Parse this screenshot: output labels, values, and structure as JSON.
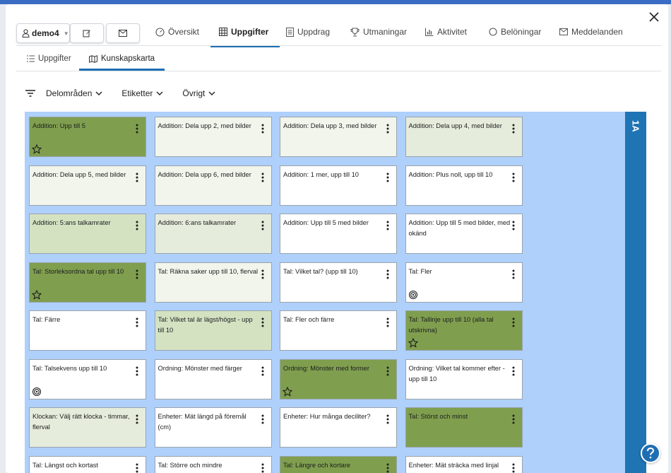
{
  "header": {
    "user_name": "demo4",
    "tabs": [
      {
        "label": "Översikt",
        "icon": "dashboard-icon"
      },
      {
        "label": "Uppgifter",
        "icon": "table-icon",
        "active": true
      },
      {
        "label": "Uppdrag",
        "icon": "document-icon"
      },
      {
        "label": "Utmaningar",
        "icon": "trophy-icon"
      },
      {
        "label": "Aktivitet",
        "icon": "bar-chart-icon"
      },
      {
        "label": "Belöningar",
        "icon": "circle-icon"
      },
      {
        "label": "Meddelanden",
        "icon": "envelope-icon"
      }
    ]
  },
  "subtabs": [
    {
      "label": "Uppgifter",
      "icon": "list-icon"
    },
    {
      "label": "Kunskapskarta",
      "icon": "map-icon",
      "active": true
    }
  ],
  "filters": [
    "Delområden",
    "Etiketter",
    "Övrigt"
  ],
  "board": {
    "level_label": "1A",
    "colors": {
      "done": "#7f9f4f",
      "light": "#f1f5ec",
      "mid": "#e5ecdc",
      "pale": "#d4e2c2",
      "empty": "#ffffff"
    },
    "cards": [
      {
        "text": "Addition: Upp till 5",
        "status": "done",
        "badge": "star-icon"
      },
      {
        "text": "Addition: Dela upp 2, med bilder",
        "status": "light",
        "badge": ""
      },
      {
        "text": "Addition: Dela upp 3, med bilder",
        "status": "light",
        "badge": ""
      },
      {
        "text": "Addition: Dela upp 4, med bilder",
        "status": "mid",
        "badge": ""
      },
      {
        "text": "Addition: Dela upp 5, med bilder",
        "status": "light",
        "badge": ""
      },
      {
        "text": "Addition: Dela upp 6, med bilder",
        "status": "light",
        "badge": ""
      },
      {
        "text": "Addition: 1 mer, upp till 10",
        "status": "empty",
        "badge": ""
      },
      {
        "text": "Addition: Plus noll, upp till 10",
        "status": "empty",
        "badge": ""
      },
      {
        "text": "Addition: 5:ans talkamrater",
        "status": "pale",
        "badge": ""
      },
      {
        "text": "Addition: 6:ans talkamrater",
        "status": "mid",
        "badge": ""
      },
      {
        "text": "Addition: Upp till 5 med bilder",
        "status": "empty",
        "badge": ""
      },
      {
        "text": "Addition: Upp till 5 med bilder, med okänd",
        "status": "empty",
        "badge": ""
      },
      {
        "text": "Tal: Storleksordna tal upp till 10",
        "status": "done",
        "badge": "star-icon"
      },
      {
        "text": "Tal: Räkna saker upp till 10, flerval",
        "status": "light",
        "badge": ""
      },
      {
        "text": "Tal: Vilket tal? (upp till 10)",
        "status": "empty",
        "badge": ""
      },
      {
        "text": "Tal: Fler",
        "status": "empty",
        "badge": "target-icon"
      },
      {
        "text": "Tal: Färre",
        "status": "empty",
        "badge": ""
      },
      {
        "text": "Tal: Vilket tal är lägst/högst - upp till 10",
        "status": "pale",
        "badge": ""
      },
      {
        "text": "Tal: Fler och färre",
        "status": "empty",
        "badge": ""
      },
      {
        "text": "Tal: Tallinje upp till 10 (alla tal utskrivna)",
        "status": "done",
        "badge": "star-icon"
      },
      {
        "text": "Tal: Talsekvens upp till 10",
        "status": "empty",
        "badge": "target-icon"
      },
      {
        "text": "Ordning: Mönster med färger",
        "status": "empty",
        "badge": ""
      },
      {
        "text": "Ordning: Mönster med former",
        "status": "done",
        "badge": "star-icon"
      },
      {
        "text": "Ordning: Vilket tal kommer efter - upp till 10",
        "status": "empty",
        "badge": ""
      },
      {
        "text": "Klockan: Välj rätt klocka - timmar, flerval",
        "status": "mid",
        "badge": ""
      },
      {
        "text": "Enheter: Mät längd på föremål (cm)",
        "status": "empty",
        "badge": ""
      },
      {
        "text": "Enheter: Hur många deciliter?",
        "status": "empty",
        "badge": ""
      },
      {
        "text": "Tal: Störst och minst",
        "status": "done",
        "badge": ""
      },
      {
        "text": "Tal: Längst och kortast",
        "status": "empty",
        "badge": ""
      },
      {
        "text": "Tal: Större och mindre",
        "status": "empty",
        "badge": ""
      },
      {
        "text": "Tal: Längre och kortare",
        "status": "done",
        "badge": ""
      },
      {
        "text": "Enheter: Mät sträcka med linjal",
        "status": "empty",
        "badge": ""
      }
    ]
  }
}
